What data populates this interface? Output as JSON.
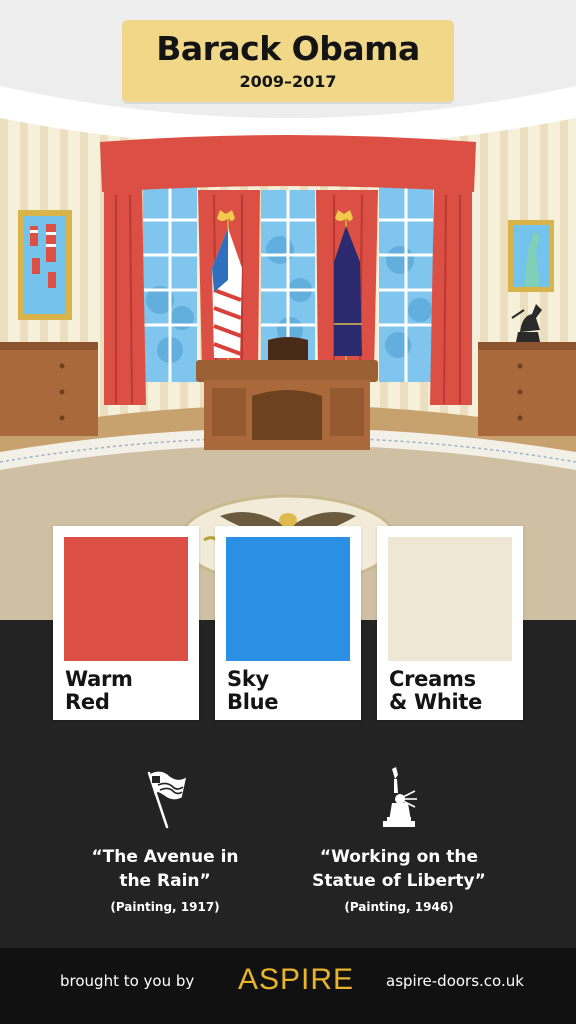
{
  "header": {
    "name": "Barack Obama",
    "years": "2009–2017"
  },
  "scene": {
    "icons": [
      "flag-icon",
      "presidential-flag-icon",
      "eagle-icon",
      "desk-icon",
      "painting-icon",
      "statue-icon"
    ]
  },
  "palette": [
    {
      "label": "Warm\nRed",
      "color": "#dc4f44"
    },
    {
      "label": "Sky\nBlue",
      "color": "#2b90e4"
    },
    {
      "label": "Creams\n& White",
      "color": "#efe7d5"
    }
  ],
  "facts": [
    {
      "icon": "waving-flag-icon",
      "quote": "“The Avenue in\nthe Rain”",
      "sub": "(Painting, 1917)"
    },
    {
      "icon": "statue-of-liberty-icon",
      "quote": "“Working on the\nStatue of Liberty”",
      "sub": "(Painting, 1946)"
    }
  ],
  "footer": {
    "left": "brought to you by",
    "brand": "ASPIRE",
    "right": "aspire-doors.co.uk"
  },
  "colors": {
    "curtain": "#dc4f44",
    "window": "#7fc5ee",
    "plaque": "#f1d889",
    "wood": "#a9693a",
    "carpet": "#cfc0a3",
    "background": "#232323",
    "footer": "#111111",
    "brand": "#e8b42c"
  }
}
